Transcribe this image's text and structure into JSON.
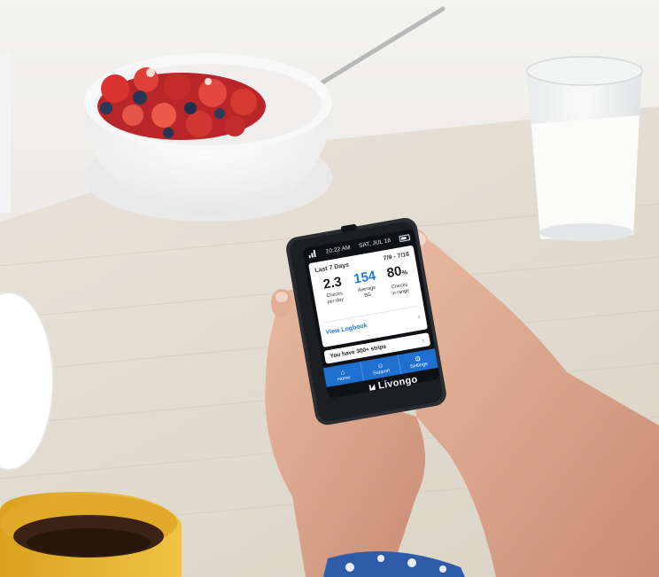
{
  "device": {
    "status_time": "10:22 AM",
    "status_date": "SAT, JUL 16",
    "card_title": "Last 7 Days",
    "card_range": "7/9 - 7/16",
    "stats": [
      {
        "value": "2.3",
        "unit": "",
        "label_line1": "Checks",
        "label_line2": "per day"
      },
      {
        "value": "154",
        "unit": "",
        "label_line1": "Average",
        "label_line2": "BG"
      },
      {
        "value": "80",
        "unit": "%",
        "label_line1": "Checks",
        "label_line2": "in range"
      }
    ],
    "logbook_label": "View Logbook",
    "strips_message": "You have 300+ strips",
    "nav": [
      {
        "label": "Home",
        "icon": "home-icon"
      },
      {
        "label": "Support",
        "icon": "people-icon"
      },
      {
        "label": "Settings",
        "icon": "gear-icon"
      }
    ],
    "brand_name": "Livongo"
  },
  "colors": {
    "accent_blue": "#1f7ad8",
    "nav_blue": "#1f6fd0",
    "device_body": "#2a2d31"
  }
}
